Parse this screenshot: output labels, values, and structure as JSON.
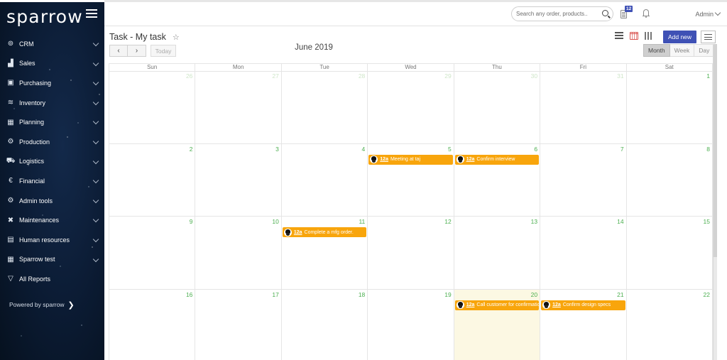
{
  "sidebar": {
    "logo": "sparrow",
    "items": [
      {
        "label": "CRM",
        "icon": "crm-icon",
        "glyph": "⊚",
        "has_children": true
      },
      {
        "label": "Sales",
        "icon": "chart-bars-icon",
        "glyph": "▟",
        "has_children": true
      },
      {
        "label": "Purchasing",
        "icon": "purchasing-icon",
        "glyph": "▣",
        "has_children": true
      },
      {
        "label": "Inventory",
        "icon": "inventory-stack-icon",
        "glyph": "≋",
        "has_children": true
      },
      {
        "label": "Planning",
        "icon": "planning-calendar-icon",
        "glyph": "▦",
        "has_children": true
      },
      {
        "label": "Production",
        "icon": "production-gear-icon",
        "glyph": "⚙",
        "has_children": true
      },
      {
        "label": "Logistics",
        "icon": "truck-icon",
        "glyph": "⛟",
        "has_children": true
      },
      {
        "label": "Financial",
        "icon": "euro-icon",
        "glyph": "€",
        "has_children": true
      },
      {
        "label": "Admin tools",
        "icon": "admin-gear-icon",
        "glyph": "⚙",
        "has_children": true
      },
      {
        "label": "Maintenances",
        "icon": "tools-icon",
        "glyph": "✖",
        "has_children": true
      },
      {
        "label": "Human resources",
        "icon": "id-card-icon",
        "glyph": "▤",
        "has_children": true
      },
      {
        "label": "Sparrow test",
        "icon": "test-calendar-icon",
        "glyph": "▦",
        "has_children": true
      },
      {
        "label": "All Reports",
        "icon": "filter-icon",
        "glyph": "▽",
        "has_children": false
      }
    ],
    "powered_by": "Powered by sparrow",
    "powered_icon": "sparrow-bird-icon"
  },
  "topbar": {
    "search_placeholder": "Search any order, products..",
    "tasks_badge": "12",
    "user": "Admin"
  },
  "page": {
    "title": "Task - My task",
    "today_label": "Today",
    "prev_label": "‹",
    "next_label": "›",
    "month_title": "June 2019",
    "add_new_label": "Add new",
    "views": [
      {
        "label": "Month",
        "active": true
      },
      {
        "label": "Week",
        "active": false
      },
      {
        "label": "Day",
        "active": false
      }
    ]
  },
  "calendar": {
    "weekdays": [
      "Sun",
      "Mon",
      "Tue",
      "Wed",
      "Thu",
      "Fri",
      "Sat"
    ],
    "today": 20,
    "weeks": [
      [
        {
          "day": "26",
          "other": true
        },
        {
          "day": "27",
          "other": true
        },
        {
          "day": "28",
          "other": true
        },
        {
          "day": "29",
          "other": true
        },
        {
          "day": "30",
          "other": true
        },
        {
          "day": "31",
          "other": true
        },
        {
          "day": "1"
        }
      ],
      [
        {
          "day": "2"
        },
        {
          "day": "3"
        },
        {
          "day": "4"
        },
        {
          "day": "5",
          "event": {
            "time": "12a",
            "title": "Meeting at taj"
          }
        },
        {
          "day": "6",
          "event": {
            "time": "12a",
            "title": "Confirm interview"
          }
        },
        {
          "day": "7"
        },
        {
          "day": "8"
        }
      ],
      [
        {
          "day": "9"
        },
        {
          "day": "10"
        },
        {
          "day": "11",
          "event": {
            "time": "12a",
            "title": "Complete a mfg order."
          }
        },
        {
          "day": "12"
        },
        {
          "day": "13"
        },
        {
          "day": "14"
        },
        {
          "day": "15"
        }
      ],
      [
        {
          "day": "16"
        },
        {
          "day": "17"
        },
        {
          "day": "18"
        },
        {
          "day": "19"
        },
        {
          "day": "20",
          "today": true,
          "event": {
            "time": "12a",
            "title": "Call customer for confirmation"
          }
        },
        {
          "day": "21",
          "event": {
            "time": "12a",
            "title": "Confirm design specs"
          }
        },
        {
          "day": "22"
        }
      ]
    ]
  },
  "colors": {
    "accent": "#3f51b5",
    "event": "#f8a50c",
    "day_number": "#4caf50",
    "today_bg": "#fcf8e3",
    "sidebar_bg": "#0b1b33"
  }
}
